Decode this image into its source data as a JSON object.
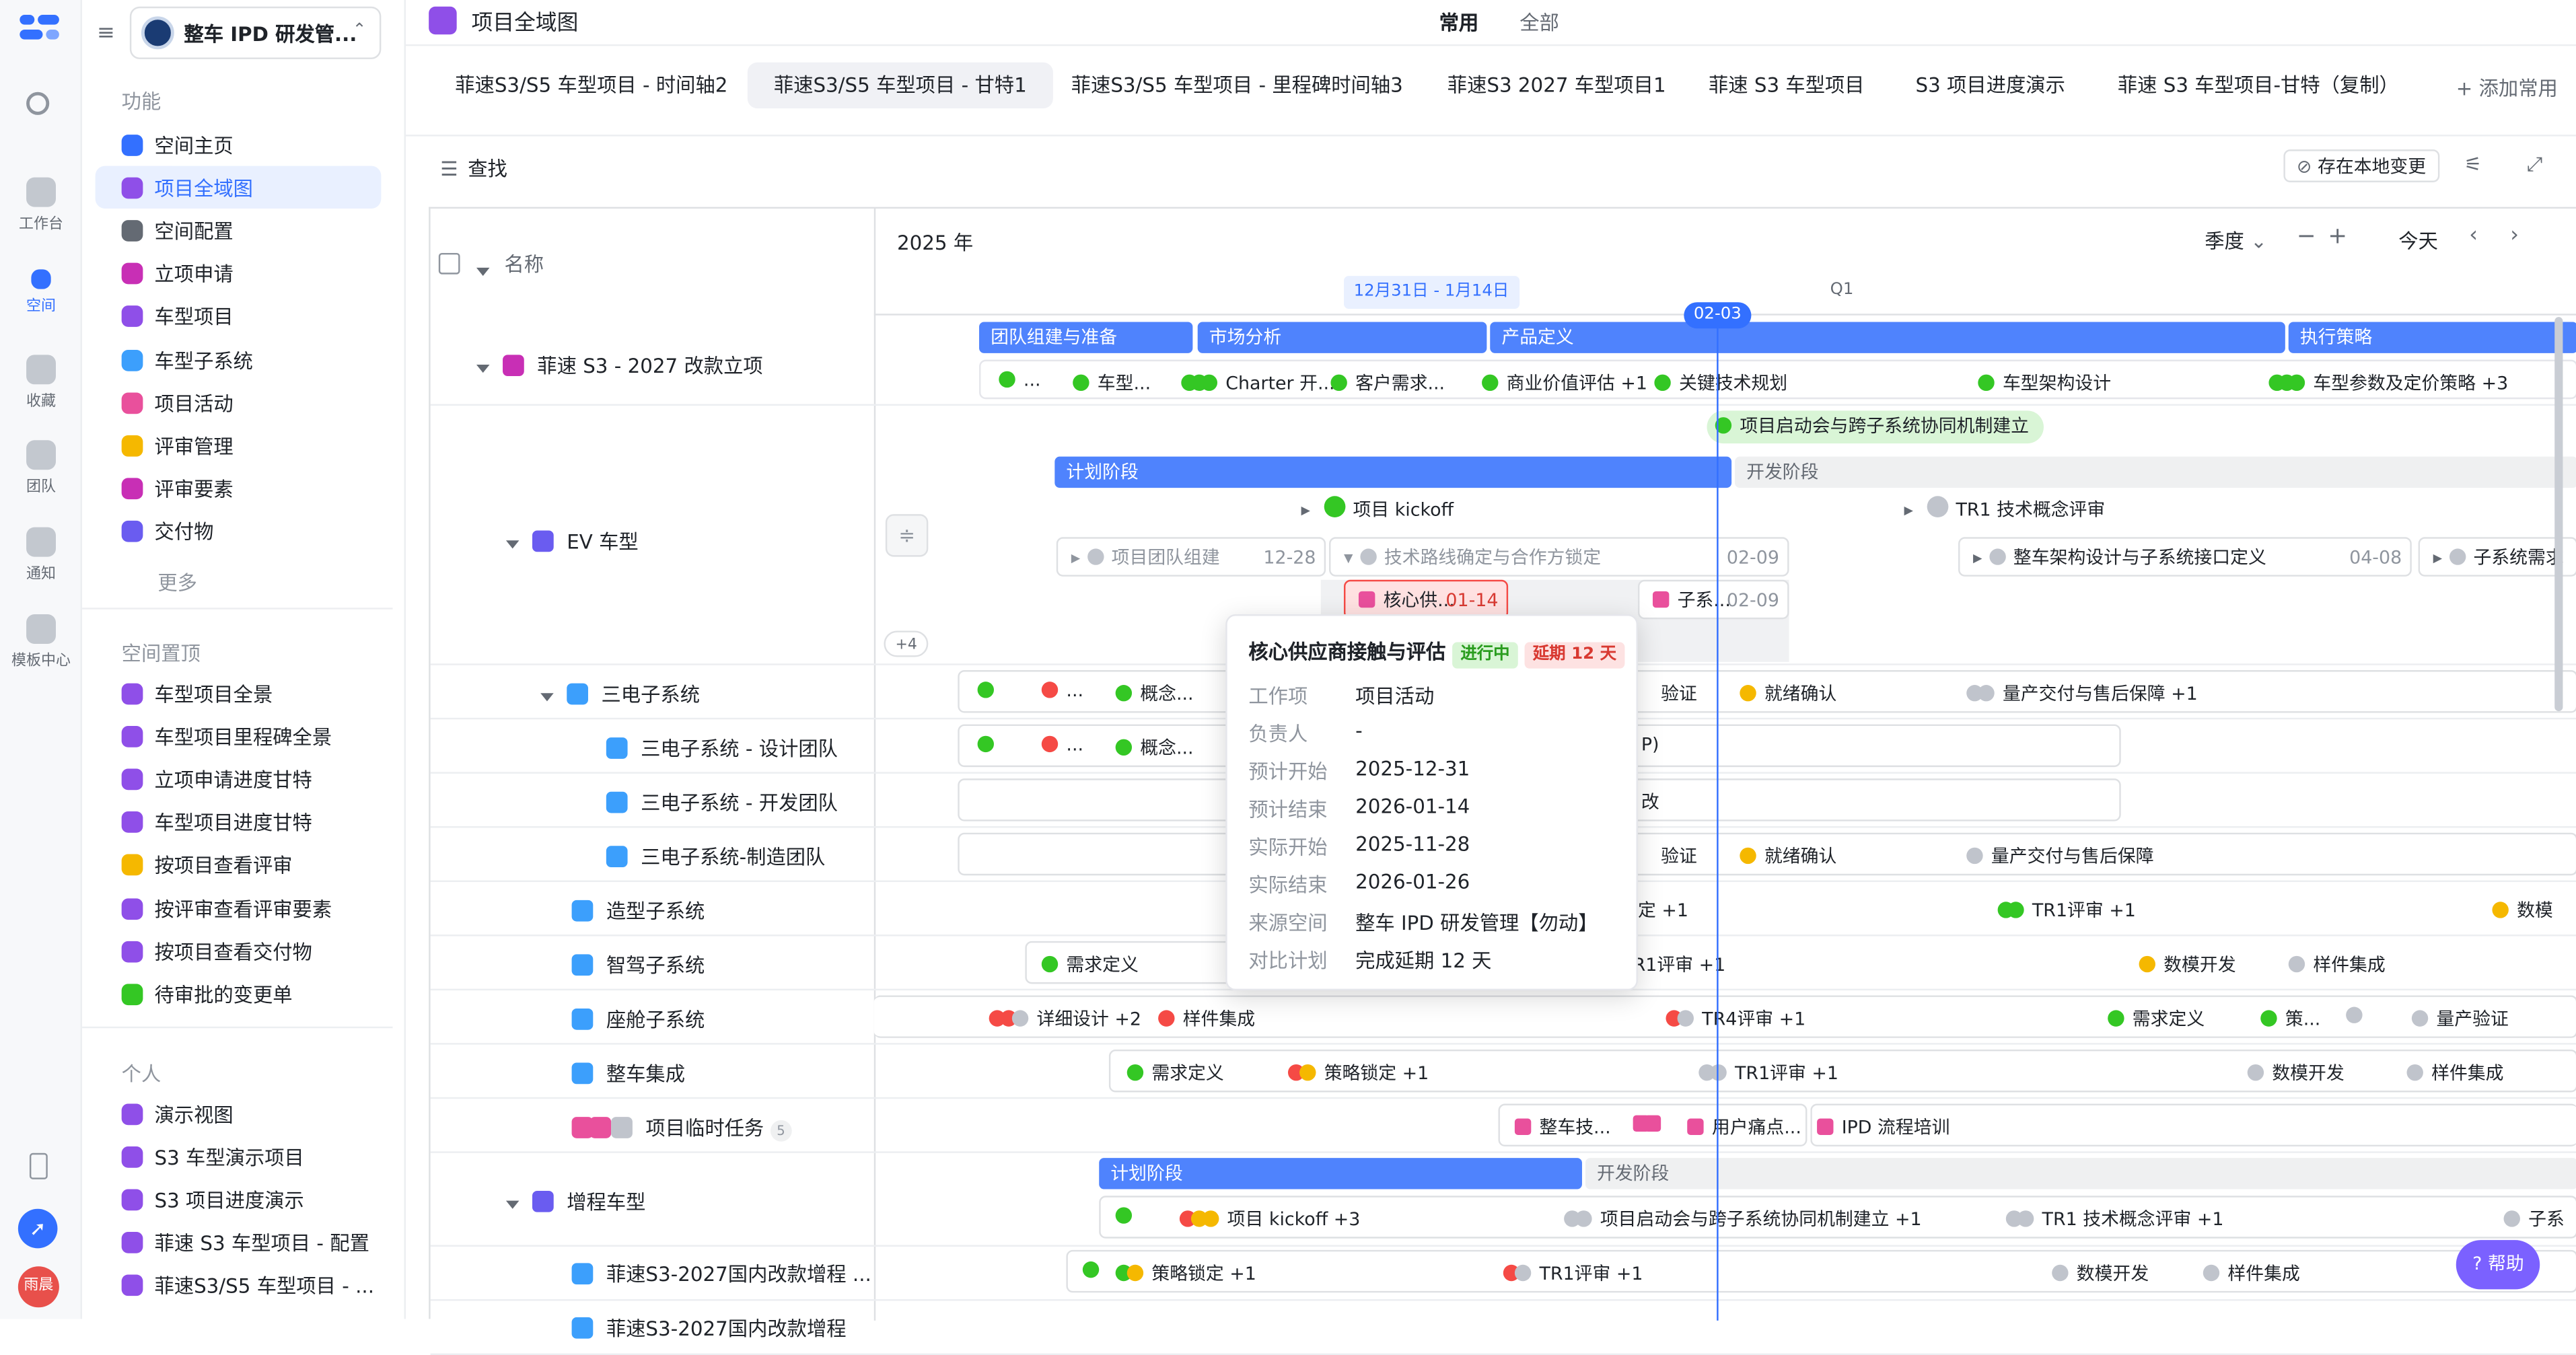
{
  "rail": {
    "items": [
      {
        "label": "工作台"
      },
      {
        "label": "空间"
      },
      {
        "label": "收藏"
      },
      {
        "label": "团队"
      },
      {
        "label": "通知"
      },
      {
        "label": "模板中心"
      }
    ],
    "avatar": "雨晨"
  },
  "sidebar": {
    "space_name": "整车 IPD 研发管...",
    "section_func": "功能",
    "func_items": [
      {
        "label": "空间主页",
        "color": "#3370ff"
      },
      {
        "label": "项目全域图",
        "color": "#8f4fe8"
      },
      {
        "label": "空间配置",
        "color": "#646a73"
      },
      {
        "label": "立项申请",
        "color": "#c82fb5"
      },
      {
        "label": "车型项目",
        "color": "#8f4fe8"
      },
      {
        "label": "车型子系统",
        "color": "#3c9ffc"
      },
      {
        "label": "项目活动",
        "color": "#e9509c"
      },
      {
        "label": "评审管理",
        "color": "#f5b800"
      },
      {
        "label": "评审要素",
        "color": "#c82fb5"
      },
      {
        "label": "交付物",
        "color": "#6a5cf0"
      }
    ],
    "more": "更多",
    "section_pinned": "空间置顶",
    "pinned_items": [
      {
        "label": "车型项目全景",
        "color": "#8f4fe8"
      },
      {
        "label": "车型项目里程碑全景",
        "color": "#8f4fe8"
      },
      {
        "label": "立项申请进度甘特",
        "color": "#8f4fe8"
      },
      {
        "label": "车型项目进度甘特",
        "color": "#8f4fe8"
      },
      {
        "label": "按项目查看评审",
        "color": "#f5b800"
      },
      {
        "label": "按评审查看评审要素",
        "color": "#8f4fe8"
      },
      {
        "label": "按项目查看交付物",
        "color": "#8f4fe8"
      },
      {
        "label": "待审批的变更单",
        "color": "#34c724"
      }
    ],
    "section_personal": "个人",
    "personal_items": [
      {
        "label": "演示视图",
        "color": "#8f4fe8"
      },
      {
        "label": "S3 车型演示项目",
        "color": "#8f4fe8"
      },
      {
        "label": "S3 项目进度演示",
        "color": "#8f4fe8"
      },
      {
        "label": "菲速 S3 车型项目 - 配置",
        "color": "#8f4fe8"
      },
      {
        "label": "菲速S3/S5 车型项目 - ...",
        "color": "#8f4fe8"
      }
    ]
  },
  "header": {
    "title": "项目全域图",
    "seg_common": "常用",
    "seg_all": "全部"
  },
  "tabs": [
    "菲速S3/S5 车型项目 - 时间轴2",
    "菲速S3/S5 车型项目 - 甘特1",
    "菲速S3/S5 车型项目 - 里程碑时间轴3",
    "菲速S3 2027 车型项目1",
    "菲速 S3 车型项目",
    "S3 项目进度演示",
    "菲速 S3 车型项目-甘特（复制）"
  ],
  "add_common": "添加常用",
  "toolbar": {
    "search": "查找",
    "save_local": "存在本地变更"
  },
  "gantt": {
    "col_name": "名称",
    "year": "2025 年",
    "scale": "季度",
    "today": "今天",
    "range_label": "12月31日 - 1月14日",
    "quarter": "Q1",
    "today_marker": "02-03",
    "more_count": "+4",
    "help": "帮助"
  },
  "rows": {
    "r1": "菲速 S3 - 2027 改款立项",
    "r2": "EV 车型",
    "r3": "三电子系统",
    "r4": "三电子系统 - 设计团队",
    "r5": "三电子系统 - 开发团队",
    "r6": "三电子系统-制造团队",
    "r7": "造型子系统",
    "r8": "智驾子系统",
    "r9": "座舱子系统",
    "r10": "整车集成",
    "r11": "项目临时任务",
    "r11_badge": "5",
    "r12": "增程车型",
    "r13": "菲速S3-2027国内改款增程 ...",
    "r14": "菲速S3-2027国内改款增程"
  },
  "bars": {
    "b1": "团队组建与准备",
    "b2": "市场分析",
    "b3": "产品定义",
    "b4": "执行策略",
    "b5": "计划阶段",
    "b6": "开发阶段",
    "b7": "计划阶段",
    "b8": "开发阶段"
  },
  "ms": {
    "m1": "...",
    "m2": "车型...",
    "m3": "Charter 开...",
    "m4": "客户需求...",
    "m5": "商业价值评估 +1",
    "m6": "关键技术规划",
    "m7": "车型架构设计",
    "m8": "车型参数及定价策略 +3",
    "m9": "项目启动会与跨子系统协同机制建立",
    "m10": "项目 kickoff",
    "m11": "TR1 技术概念评审",
    "m12": "项目团队组建",
    "m12d": "12-28",
    "m13": "技术路线确定与合作方锁定",
    "m13d": "02-09",
    "m14": "整车架构设计与子系统接口定义",
    "m14d": "04-08",
    "m15": "子系统需求",
    "m16": "核心供...",
    "m16d": "01-14",
    "m17": "子系...",
    "m17d": "02-09",
    "r3a": "...",
    "r3b": "概念...",
    "r3c": "验证",
    "r3d": "就绪确认",
    "r3e": "量产交付与售后保障 +1",
    "r4a": "...",
    "r4b": "概念...",
    "r4c": "P)",
    "r5c": "改",
    "r6c": "验证",
    "r6d": "就绪确认",
    "r6e": "量产交付与售后保障",
    "r7c": "定 +1",
    "r7d": "TR1评审 +1",
    "r7e": "数模",
    "r8a": "需求定义",
    "r8c": "R1评审 +1",
    "r8d": "数模开发",
    "r8e": "样件集成",
    "r9a": "详细设计 +2",
    "r9b": "样件集成",
    "r9c": "TR4评审 +1",
    "r9d": "需求定义",
    "r9e": "策...",
    "r9f": "量产验证",
    "r10a": "需求定义",
    "r10b": "策略锁定 +1",
    "r10c": "TR1评审 +1",
    "r10d": "数模开发",
    "r10e": "样件集成",
    "r11a": "整车技...",
    "r11b": "用户痛点...",
    "r11c": "IPD 流程培训",
    "r12a": "项目 kickoff +3",
    "r12b": "项目启动会与跨子系统协同机制建立 +1",
    "r12c": "TR1 技术概念评审 +1",
    "r12d": "子系",
    "r13a": "策略锁定 +1",
    "r13b": "TR1评审 +1",
    "r13c": "数模开发",
    "r13d": "样件集成"
  },
  "popover": {
    "title": "核心供应商接触与评估",
    "status": "进行中",
    "delay": "延期 12 天",
    "fields": [
      {
        "k": "工作项",
        "v": "项目活动"
      },
      {
        "k": "负责人",
        "v": "-"
      },
      {
        "k": "预计开始",
        "v": "2025-12-31"
      },
      {
        "k": "预计结束",
        "v": "2026-01-14"
      },
      {
        "k": "实际开始",
        "v": "2025-11-28"
      },
      {
        "k": "实际结束",
        "v": "2026-01-26"
      },
      {
        "k": "来源空间",
        "v": "整车 IPD 研发管理【勿动】"
      },
      {
        "k": "对比计划",
        "v": "完成延期 12 天"
      }
    ]
  }
}
